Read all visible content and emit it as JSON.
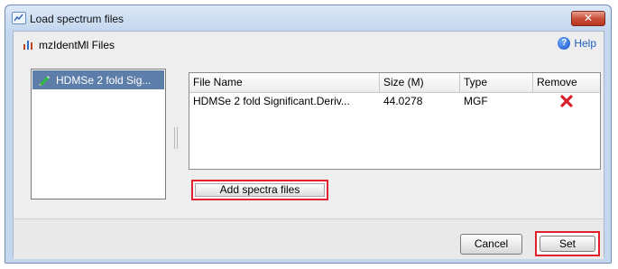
{
  "window": {
    "title": "Load spectrum files",
    "close_glyph": "✕"
  },
  "header": {
    "files_label": "mzIdentMl Files",
    "help_label": "Help",
    "help_glyph": "?"
  },
  "file_list": {
    "items": [
      {
        "label": "HDMSe 2 fold Sig...",
        "icon": "pencil-icon",
        "selected": true
      }
    ]
  },
  "spectra_table": {
    "columns": [
      "File Name",
      "Size (M)",
      "Type",
      "Remove"
    ],
    "rows": [
      {
        "file_name": "HDMSe 2 fold Significant.Deriv...",
        "size": "44.0278",
        "type": "MGF",
        "remove_icon": "remove-x-icon"
      }
    ]
  },
  "actions": {
    "add_spectra": "Add spectra files",
    "cancel": "Cancel",
    "set": "Set"
  },
  "colors": {
    "highlight_border": "#e0202a",
    "selection": "#5c7ea9",
    "remove_x": "#d8222b",
    "link": "#1f5fbf"
  }
}
